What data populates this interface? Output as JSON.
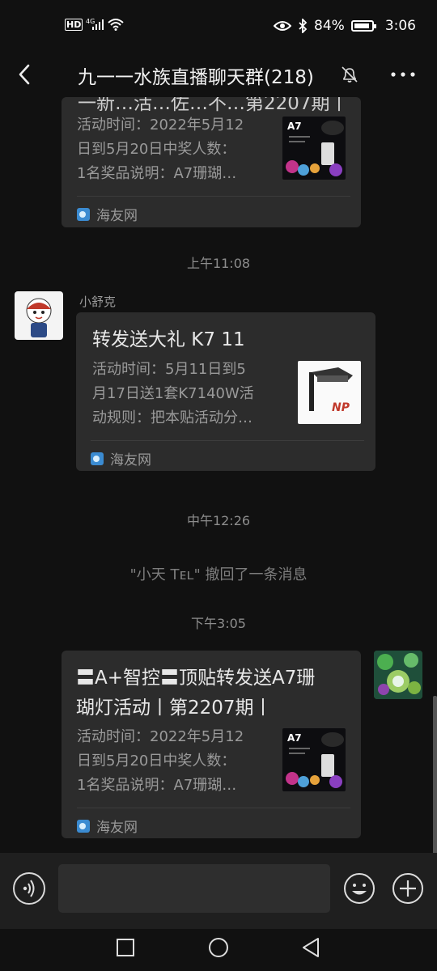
{
  "status_bar": {
    "network": "HD 4G",
    "battery": "84%",
    "time": "3:06"
  },
  "header": {
    "title": "九一一水族直播聊天群(218)",
    "back_icon": "back-arrow-icon",
    "mute_icon": "bell-muted-icon",
    "more_icon": "more-dots-icon"
  },
  "messages": {
    "m1": {
      "title_partial": "一新…活…佐…不…第2207期丨",
      "desc": "活动时间：2022年5月12日到5月20日中奖人数：1名奖品说明：A7珊瑚…",
      "desc_l1": "活动时间：2022年5月12",
      "desc_l2": "日到5月20日中奖人数：",
      "desc_l3": "1名奖品说明：A7珊瑚…",
      "source": "海友网",
      "thumb_label": "A7"
    },
    "t1": "上午11:08",
    "m2": {
      "sender": "小舒克",
      "title": "转发送大礼 K7 11",
      "desc_l1": "活动时间：5月11日到5",
      "desc_l2": "月17日送1套K7140W活",
      "desc_l3": "动规则：把本贴活动分…",
      "source": "海友网",
      "thumb_label": "NP"
    },
    "t2": "中午12:26",
    "recall": "\"小天 Tᴇʟ\" 撤回了一条消息",
    "t3": "下午3:05",
    "m3": {
      "title_l1": "〓A+智控〓顶贴转发送A7珊",
      "title_l2": "瑚灯活动丨第2207期丨",
      "desc_l1": "活动时间：2022年5月12",
      "desc_l2": "日到5月20日中奖人数：",
      "desc_l3": "1名奖品说明：A7珊瑚…",
      "source": "海友网",
      "thumb_label": "A7"
    }
  },
  "input_bar": {
    "voice_icon": "voice-icon",
    "emoji_icon": "emoji-icon",
    "plus_icon": "plus-icon",
    "text_value": ""
  },
  "nav_bar": {
    "recent_icon": "square-recent-icon",
    "home_icon": "circle-home-icon",
    "back_icon": "triangle-back-icon"
  }
}
